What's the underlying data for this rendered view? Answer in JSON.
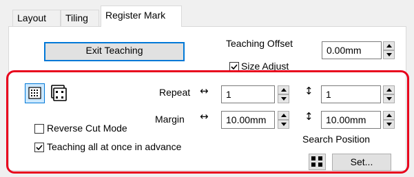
{
  "tabs": [
    {
      "label": "Layout",
      "active": false
    },
    {
      "label": "Tiling",
      "active": false
    },
    {
      "label": "Register Mark",
      "active": true
    }
  ],
  "buttons": {
    "exit_teaching": "Exit Teaching",
    "set": "Set..."
  },
  "teaching_offset": {
    "label": "Teaching Offset",
    "value": "0.00mm"
  },
  "size_adjust": {
    "label": "Size Adjust",
    "checked": true
  },
  "repeat": {
    "label": "Repeat",
    "horizontal_symbol": "↔",
    "vertical_symbol": "↕",
    "horizontal_value": "1",
    "vertical_value": "1"
  },
  "margin": {
    "label": "Margin",
    "horizontal_symbol": "↔",
    "vertical_symbol": "↕",
    "horizontal_value": "10.00mm",
    "vertical_value": "10.00mm"
  },
  "options": {
    "reverse_cut_mode": {
      "label": "Reverse Cut Mode",
      "checked": false
    },
    "teaching_all_at_once": {
      "label": "Teaching all at once in advance",
      "checked": true
    }
  },
  "search_position": {
    "label": "Search Position"
  },
  "colors": {
    "highlight_frame": "#e8001c",
    "focus_border": "#0078d7"
  },
  "icons": [
    "grid-mode-icon",
    "multi-sheet-icon",
    "search-position-icon",
    "checkmark-icon"
  ]
}
